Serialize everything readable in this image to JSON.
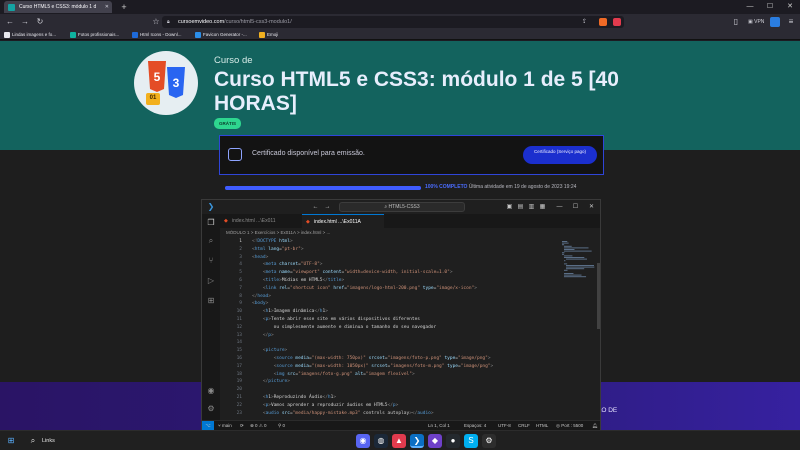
{
  "browser": {
    "tab_title": "Curso HTML5 e CSS3: módulo 1 d",
    "url_host": "cursoemvideo.com",
    "url_path": "/curso/html5-css3-modulo1/",
    "vpn_label": "VPN",
    "bookmarks": [
      {
        "label": "Lindas imagens e fo...",
        "color": "#e8e8ee"
      },
      {
        "label": "Fotos profissionais...",
        "color": "#0fb3a0"
      },
      {
        "label": "Html Icons - Downl...",
        "color": "#1e6ad9"
      },
      {
        "label": "Favicon Generator -...",
        "color": "#2b8ee8"
      },
      {
        "label": "Emoji",
        "color": "#f0b020"
      }
    ]
  },
  "course": {
    "kicker": "Curso de",
    "title": "Curso HTML5 e CSS3: módulo 1 de 5 [40 HORAS]",
    "badge": "GRÁTIS",
    "logo_badge": "01",
    "certificate_text": "Certificado disponível para emissão.",
    "certificate_button": "Certificado (Serviço pago)",
    "progress_percent": 100,
    "progress_label": "100% COMPLETO",
    "last_activity": "Última atividade em 19 de agosto de 2023 19:24",
    "promo_partial": "ÃO DE"
  },
  "vscode": {
    "search": "HTML5-CSS3",
    "tabs": [
      {
        "label": "index.html ...\\Ex011",
        "active": false
      },
      {
        "label": "index.html ...\\Ex011A",
        "active": true
      }
    ],
    "breadcrumb": "MÓDULO 1 > Exercícios > Ex011A > index.html > ...",
    "code": [
      "<!DOCTYPE html>",
      "<html lang=\"pt-br\">",
      "<head>",
      "    <meta charset=\"UTF-8\">",
      "    <meta name=\"viewport\" content=\"width=device-width, initial-scale=1.0\">",
      "    <title>Mídias em HTML5</title>",
      "    <link rel=\"shortcut icon\" href=\"imagens/logo-html-200.png\" type=\"image/x-icon\">",
      "</head>",
      "<body>",
      "    <h1>Imagem dinâmica</h1>",
      "    <p>Tente abrir esse site em vários dispositivos diferentes",
      "        ou simplesmente aumente e diminua o tamanho do seu navegador",
      "    </p>",
      "",
      "    <picture>",
      "        <source media=\"(max-width: 750px)\" srcset=\"imagens/foto-p.png\" type=\"image/png\">",
      "        <source media=\"(max-width: 1050px)\" srcset=\"imagens/foto-m.png\" type=\"image/png\">",
      "        <img src=\"imagens/foto-g.png\" alt=\"imagem flexível\">",
      "    </picture>",
      "",
      "    <h1>Reproduzindo Áudio</h1>",
      "    <p>Vamos aprender a reproduzir áudios em HTML5</p>",
      "    <audio src=\"media/happy-mistake.mp3\" controls autoplay></audio>"
    ],
    "status": {
      "branch": "main",
      "sync": "⟳",
      "problems": "⊗ 0 ⚠ 0",
      "ports": "0",
      "position": "Ln 1, Col 1",
      "spaces": "Espaços: 4",
      "encoding": "UTF-8",
      "eol": "CRLF",
      "language": "HTML",
      "port": "Port : 5500"
    }
  },
  "taskbar": {
    "search_label": "Links"
  }
}
